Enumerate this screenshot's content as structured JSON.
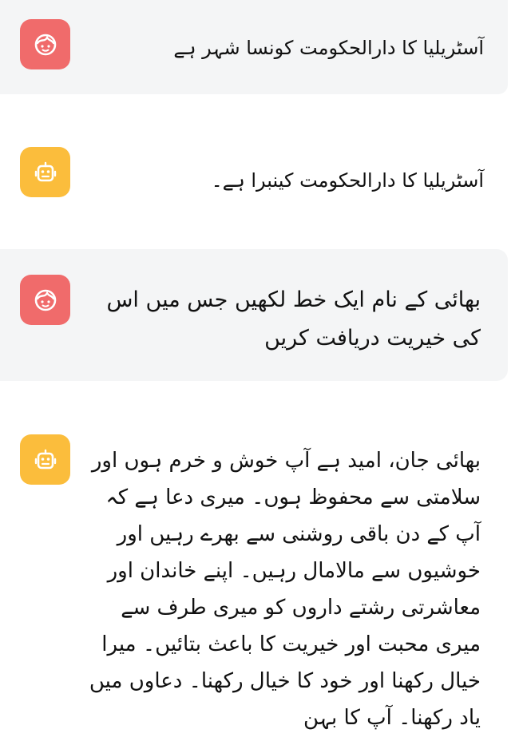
{
  "messages": [
    {
      "role": "user",
      "avatar_icon": "user-face-icon",
      "text": "آسٹریلیا کا دارالحکومت کونسا شہر ہے"
    },
    {
      "role": "bot",
      "avatar_icon": "robot-icon",
      "text": "آسٹریلیا کا دارالحکومت کینبرا ہے۔"
    },
    {
      "role": "user",
      "avatar_icon": "user-face-icon",
      "text": "بھائی کے نام ایک خط لکھیں جس میں اس کی خیریت دریافت کریں"
    },
    {
      "role": "bot",
      "avatar_icon": "robot-icon",
      "text": "بھائی جان، امید ہے آپ خوش و خرم ہوں اور سلامتی سے محفوظ ہوں۔ میری دعا ہے کہ آپ کے دن باقی روشنی سے بھرے رہیں اور خوشیوں سے مالامال رہیں۔ اپنے خاندان اور معاشرتی رشتے داروں کو میری طرف سے میری محبت اور خیریت کا باعث بتائیں۔ میرا خیال رکھنا اور خود کا خیال رکھنا۔ دعاوں میں یاد رکھنا۔ آپ کا بہن"
    }
  ],
  "colors": {
    "user_avatar_bg": "#f06b6b",
    "bot_avatar_bg": "#fbbd3c",
    "user_bubble_bg": "#f4f5f6",
    "text": "#111111"
  }
}
